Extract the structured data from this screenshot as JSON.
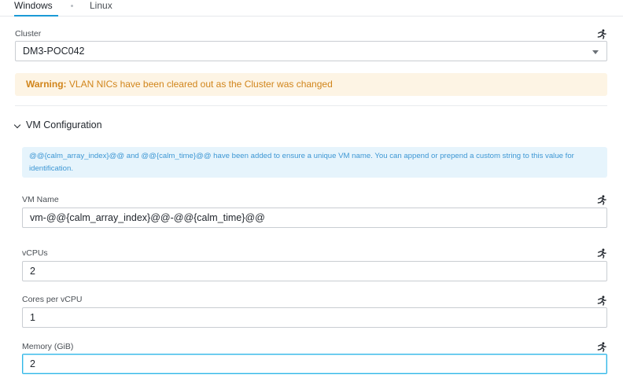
{
  "tabs": [
    {
      "label": "Windows",
      "active": true
    },
    {
      "label": "Linux",
      "active": false
    }
  ],
  "cluster": {
    "label": "Cluster",
    "value": "DM3-POC042"
  },
  "warning": {
    "bold": "Warning:",
    "text": "VLAN NICs have been cleared out as the Cluster was changed"
  },
  "vm_config": {
    "title": "VM Configuration",
    "expanded": true,
    "info": "@@{calm_array_index}@@ and @@{calm_time}@@ have been added to ensure a unique VM name. You can append or prepend a custom string to this value for identification.",
    "fields": {
      "vm_name": {
        "label": "VM Name",
        "value": "vm-@@{calm_array_index}@@-@@{calm_time}@@"
      },
      "vcpus": {
        "label": "vCPUs",
        "value": "2"
      },
      "cores": {
        "label": "Cores per vCPU",
        "value": "1"
      },
      "memory": {
        "label": "Memory (GiB)",
        "value": "2"
      }
    }
  },
  "icons": {
    "runtime": "running-man-icon"
  },
  "colors": {
    "accent": "#1b9ad6",
    "warning_text": "#d1851b",
    "warning_bg": "#fdf4e4",
    "info_text": "#3d97d4",
    "info_bg": "#e6f4fc",
    "focus_border": "#30b7e8"
  }
}
